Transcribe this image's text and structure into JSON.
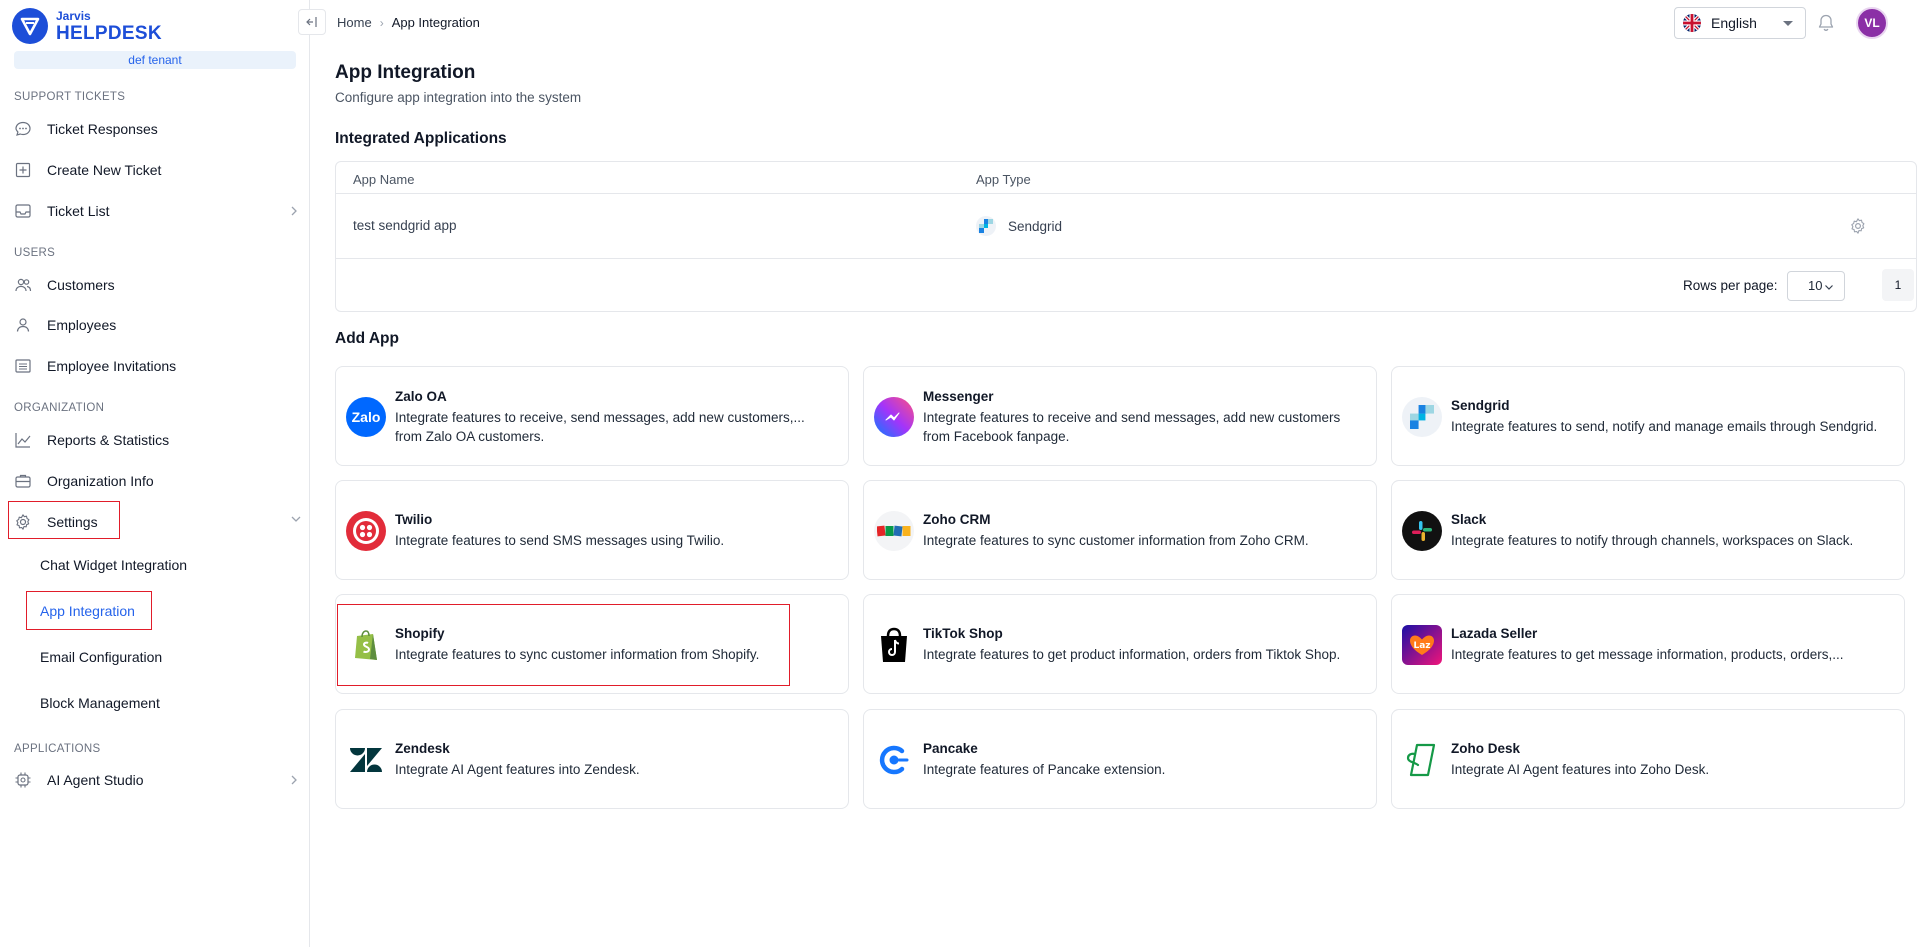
{
  "brand": {
    "small": "Jarvis",
    "big": "HELPDESK",
    "tenant": "def tenant"
  },
  "sidebar": {
    "sections": {
      "support": "SUPPORT TICKETS",
      "users": "USERS",
      "organization": "ORGANIZATION",
      "applications": "APPLICATIONS"
    },
    "items": {
      "ticket_responses": "Ticket Responses",
      "create_ticket": "Create New Ticket",
      "ticket_list": "Ticket List",
      "customers": "Customers",
      "employees": "Employees",
      "employee_invitations": "Employee Invitations",
      "reports": "Reports & Statistics",
      "org_info": "Organization Info",
      "settings": "Settings",
      "ai_agent_studio": "AI Agent Studio"
    },
    "settings_sub": {
      "chat_widget": "Chat Widget Integration",
      "app_integration": "App Integration",
      "email_config": "Email Configuration",
      "block_mgmt": "Block Management"
    }
  },
  "breadcrumb": {
    "home": "Home",
    "current": "App Integration"
  },
  "header": {
    "language": "English",
    "avatar_initials": "VL"
  },
  "page": {
    "title": "App Integration",
    "subtitle": "Configure app integration into the system",
    "integrated_title": "Integrated Applications",
    "add_title": "Add App"
  },
  "table": {
    "col_name": "App Name",
    "col_type": "App Type",
    "row": {
      "name": "test sendgrid app",
      "type": "Sendgrid"
    },
    "rows_per_page_label": "Rows per page:",
    "rows_per_page": "10",
    "page": "1"
  },
  "apps": [
    {
      "name": "Zalo OA",
      "desc": "Integrate features to receive, send messages, add new customers,... from Zalo OA customers.",
      "icon": "zalo-icon",
      "color": "#0068ff"
    },
    {
      "name": "Messenger",
      "desc": "Integrate features to receive and send messages, add new customers from Facebook fanpage.",
      "icon": "messenger-icon",
      "color": "#a334fa"
    },
    {
      "name": "Sendgrid",
      "desc": "Integrate features to send, notify and manage emails through Sendgrid.",
      "icon": "sendgrid-icon",
      "color": "#1a82e2"
    },
    {
      "name": "Twilio",
      "desc": "Integrate features to send SMS messages using Twilio.",
      "icon": "twilio-icon",
      "color": "#e22c3a"
    },
    {
      "name": "Zoho CRM",
      "desc": "Integrate features to sync customer information from Zoho CRM.",
      "icon": "zoho-crm-icon",
      "color": "#e42527"
    },
    {
      "name": "Slack",
      "desc": "Integrate features to notify through channels, workspaces on Slack.",
      "icon": "slack-icon",
      "color": "#111111"
    },
    {
      "name": "Shopify",
      "desc": "Integrate features to sync customer information from Shopify.",
      "icon": "shopify-icon",
      "color": "#95bf47"
    },
    {
      "name": "TikTok Shop",
      "desc": "Integrate features to get product information, orders from Tiktok Shop.",
      "icon": "tiktok-shop-icon",
      "color": "#000000"
    },
    {
      "name": "Lazada Seller",
      "desc": "Integrate features to get message information, products, orders,...",
      "icon": "lazada-icon",
      "color": "#1a0fa6"
    },
    {
      "name": "Zendesk",
      "desc": "Integrate AI Agent features into Zendesk.",
      "icon": "zendesk-icon",
      "color": "#03363d"
    },
    {
      "name": "Pancake",
      "desc": "Integrate features of Pancake extension.",
      "icon": "pancake-icon",
      "color": "#1677ff"
    },
    {
      "name": "Zoho Desk",
      "desc": "Integrate AI Agent features into Zoho Desk.",
      "icon": "zoho-desk-icon",
      "color": "#159947"
    }
  ]
}
